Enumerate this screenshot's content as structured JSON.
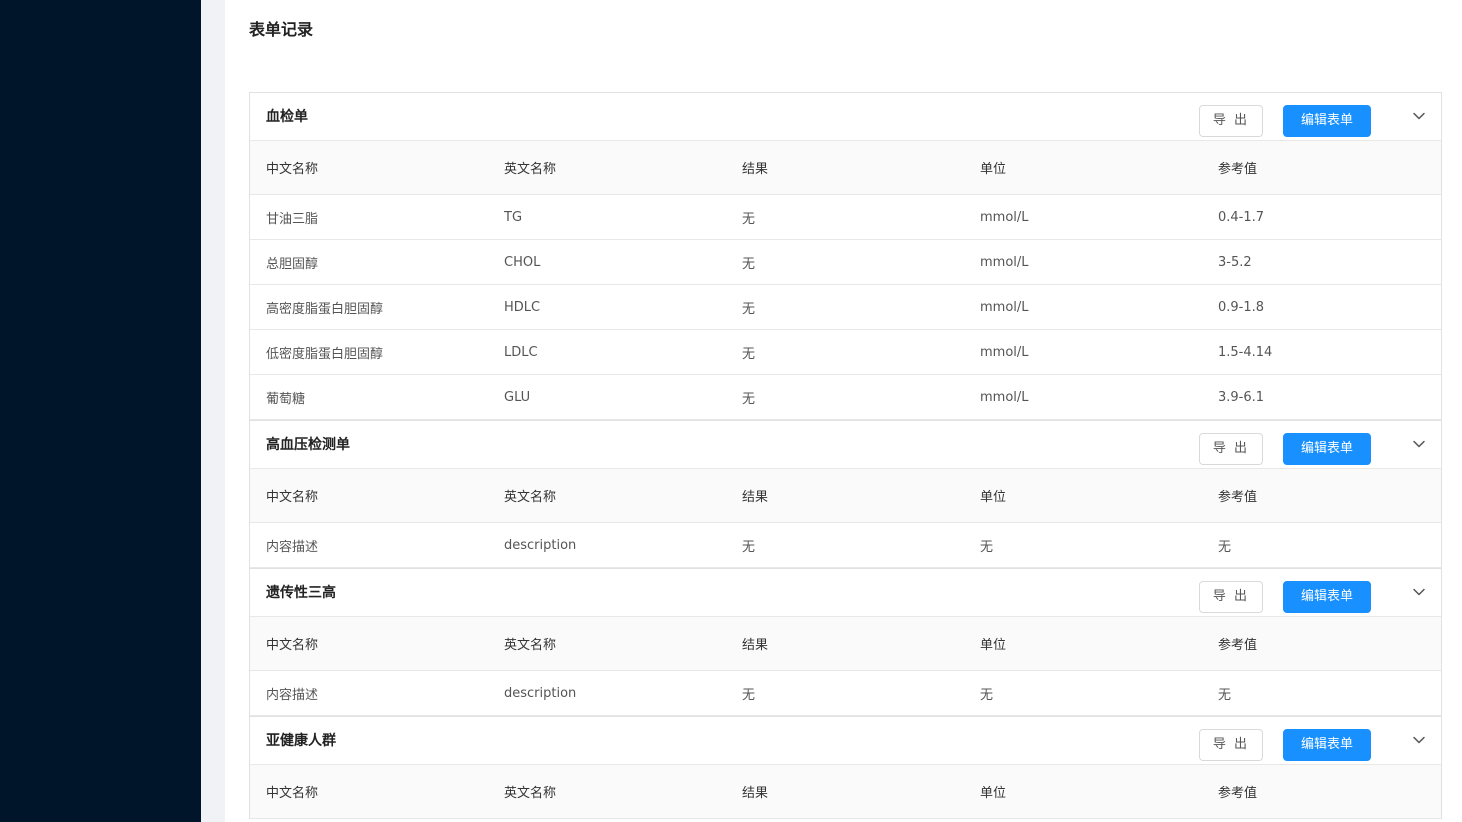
{
  "page": {
    "title": "表单记录"
  },
  "columns": [
    "中文名称",
    "英文名称",
    "结果",
    "单位",
    "参考值"
  ],
  "actions": {
    "export_label": "导 出",
    "edit_label": "编辑表单"
  },
  "forms": [
    {
      "title": "血检单",
      "rows": [
        [
          "甘油三脂",
          "TG",
          "无",
          "mmol/L",
          "0.4-1.7"
        ],
        [
          "总胆固醇",
          "CHOL",
          "无",
          "mmol/L",
          "3-5.2"
        ],
        [
          "高密度脂蛋白胆固醇",
          "HDLC",
          "无",
          "mmol/L",
          "0.9-1.8"
        ],
        [
          "低密度脂蛋白胆固醇",
          "LDLC",
          "无",
          "mmol/L",
          "1.5-4.14"
        ],
        [
          "葡萄糖",
          "GLU",
          "无",
          "mmol/L",
          "3.9-6.1"
        ]
      ]
    },
    {
      "title": "高血压检测单",
      "rows": [
        [
          "内容描述",
          "description",
          "无",
          "无",
          "无"
        ]
      ]
    },
    {
      "title": "遗传性三高",
      "rows": [
        [
          "内容描述",
          "description",
          "无",
          "无",
          "无"
        ]
      ]
    },
    {
      "title": "亚健康人群",
      "rows": []
    }
  ]
}
